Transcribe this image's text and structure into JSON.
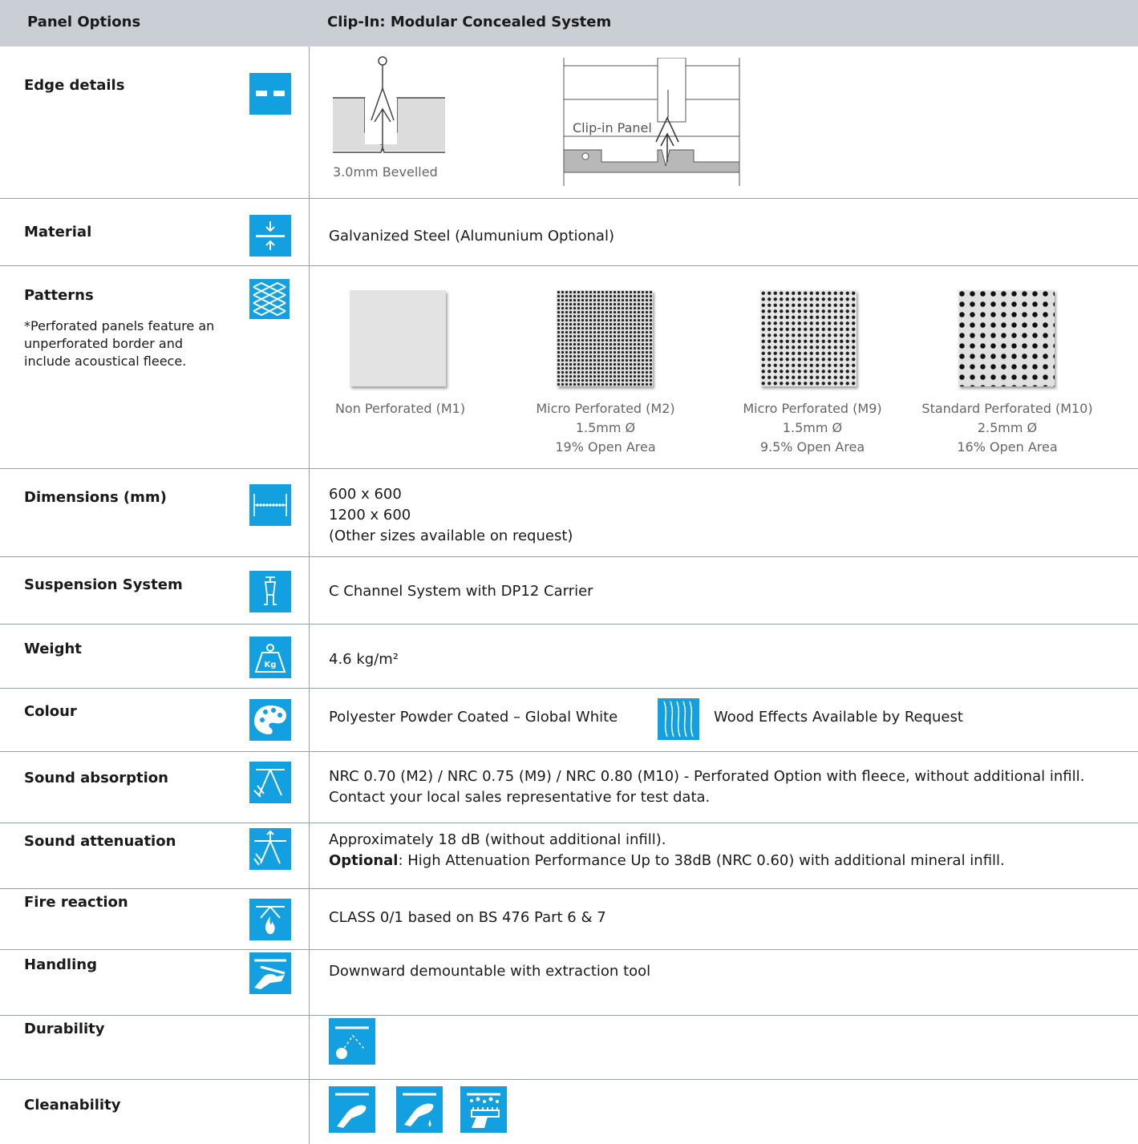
{
  "header": {
    "col1": "Panel Options",
    "col2": "Clip-In: Modular Concealed System"
  },
  "rows": {
    "edge": {
      "label": "Edge details",
      "caption": "3.0mm Bevelled",
      "diagram_label": "Clip-in Panel"
    },
    "material": {
      "label": "Material",
      "value": "Galvanized Steel (Alumunium Optional)"
    },
    "patterns": {
      "label": "Patterns",
      "note": "*Perforated panels feature an unperforated border and include acoustical fleece.",
      "items": [
        {
          "name": "Non Perforated (M1)",
          "dia": "",
          "open": ""
        },
        {
          "name": "Micro Perforated (M2)",
          "dia": "1.5mm Ø",
          "open": "19% Open Area"
        },
        {
          "name": "Micro Perforated (M9)",
          "dia": "1.5mm Ø",
          "open": "9.5% Open Area"
        },
        {
          "name": "Standard Perforated (M10)",
          "dia": "2.5mm Ø",
          "open": "16% Open Area"
        }
      ]
    },
    "dimensions": {
      "label": "Dimensions (mm)",
      "line1": "600 x 600",
      "line2": "1200 x 600",
      "line3": "(Other sizes available on request)"
    },
    "suspension": {
      "label": "Suspension System",
      "value": "C Channel System with DP12 Carrier"
    },
    "weight": {
      "label": "Weight",
      "value": "4.6 kg/m²",
      "icon_text": "Kg"
    },
    "colour": {
      "label": "Colour",
      "value": "Polyester Powder Coated – Global White",
      "wood": "Wood Effects Available by Request"
    },
    "absorption": {
      "label": "Sound absorption",
      "line1": "NRC 0.70 (M2) / NRC 0.75 (M9) / NRC 0.80 (M10) - Perforated Option with fleece, without additional infill.",
      "line2": "Contact your local sales representative for test data."
    },
    "attenuation": {
      "label": "Sound attenuation",
      "line1": "Approximately 18 dB (without additional infill).",
      "line2_bold": "Optional",
      "line2_rest": ": High Attenuation Performance Up to 38dB (NRC 0.60) with additional mineral infill."
    },
    "fire": {
      "label": "Fire reaction",
      "value": "CLASS 0/1 based on BS 476 Part 6 & 7"
    },
    "handling": {
      "label": "Handling",
      "value": "Downward demountable with extraction tool"
    },
    "durability": {
      "label": "Durability"
    },
    "cleanability": {
      "label": "Cleanability"
    }
  },
  "colors": {
    "header_bg": "#c9cfd4",
    "icon_blue": "#12a0e0",
    "rule": "#9aa0a6"
  },
  "icons": [
    "edge-icon",
    "material-icon",
    "pattern-icon",
    "dimension-icon",
    "suspension-icon",
    "weight-icon",
    "palette-icon",
    "wood-icon",
    "absorption-icon",
    "attenuation-icon",
    "fire-icon",
    "handling-icon",
    "impact-icon",
    "wipe-icon",
    "wash-icon",
    "brush-icon"
  ]
}
